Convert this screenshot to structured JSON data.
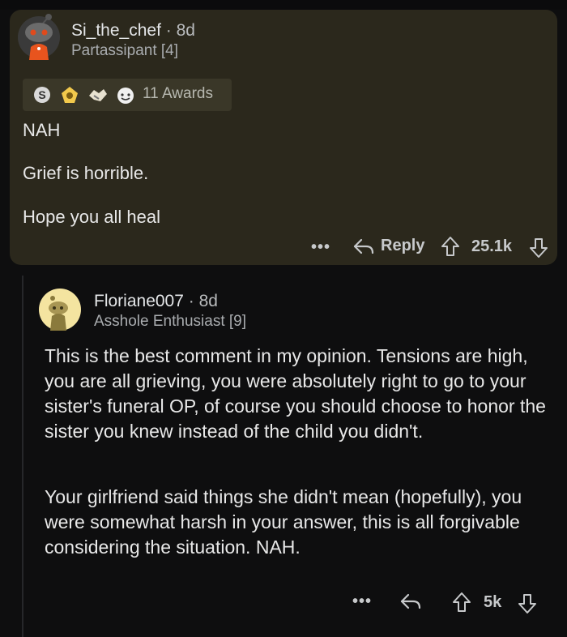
{
  "comment1": {
    "username": "Si_the_chef",
    "time": "8d",
    "flair": "Partassipant [4]",
    "awards_label": "11 Awards",
    "award_icons": [
      "silver-award-icon",
      "hero-award-icon",
      "handshake-award-icon",
      "wholesome-award-icon"
    ],
    "paragraphs": [
      "NAH",
      "Grief is horrible.",
      "Hope you all heal"
    ],
    "more_label": "•••",
    "reply_label": "Reply",
    "score": "25.1k"
  },
  "comment2": {
    "username": "Floriane007",
    "time": "8d",
    "flair": "Asshole Enthusiast [9]",
    "paragraph1": "This is the best comment in my opinion. Tensions are high, you are all grieving, you were absolutely right to go to your sister's funeral OP, of course you should choose to honor the sister you knew instead of the child you didn't.",
    "paragraph2": "Your girlfriend said things she didn't mean (hopefully), you were somewhat harsh in your answer, this is all forgivable considering the situation. NAH.",
    "more_label": "•••",
    "score": "5k"
  },
  "colors": {
    "background": "#0e0e0f",
    "highlight_card": "#2b281c",
    "text": "#e8e8e8",
    "meta": "#a9acaf"
  }
}
